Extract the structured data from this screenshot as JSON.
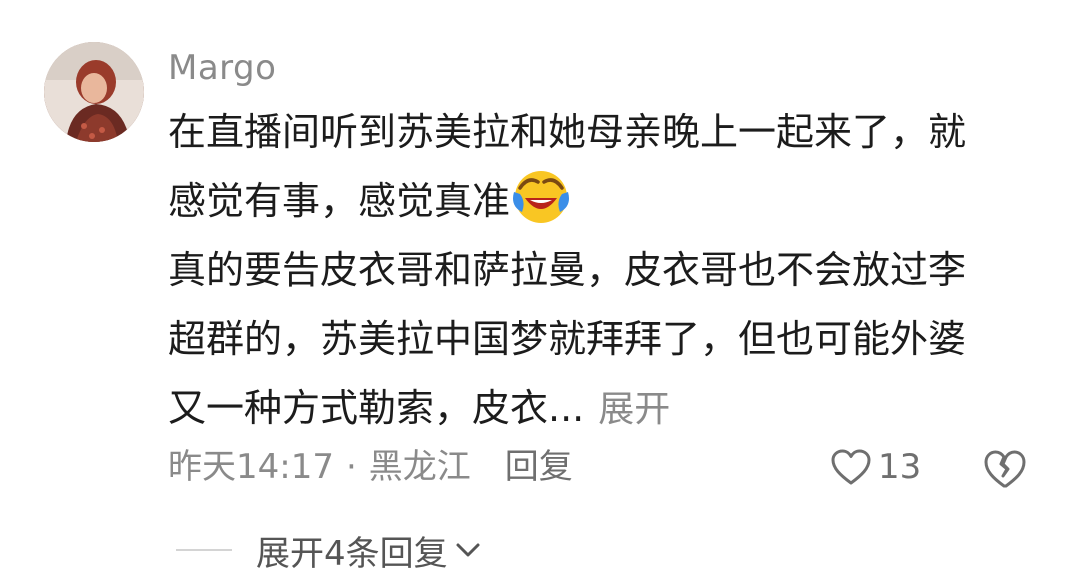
{
  "comment": {
    "username": "Margo",
    "text_lines": [
      "在直播间听到苏美拉和她母亲晚上一起来了，就",
      "感觉有事，感觉真准",
      "真的要告皮衣哥和萨拉曼，皮衣哥也不会放过李",
      "超群的，苏美拉中国梦就拜拜了，但也可能外婆",
      "又一种方式勒索，皮衣..."
    ],
    "emoji": "laughing-crying-emoji",
    "expand_label": "展开",
    "timestamp": "昨天14:17",
    "separator": "·",
    "location": "黑龙江",
    "reply_label": "回复",
    "like_count": "13",
    "expand_replies_label": "展开4条回复"
  },
  "icons": {
    "like": "heart-outline-icon",
    "dislike": "broken-heart-icon",
    "chevron": "chevron-down-icon"
  },
  "colors": {
    "primary_text": "#1c1c1c",
    "secondary_text": "#8a8a8a",
    "emoji_yellow": "#f9c623",
    "emoji_tear": "#3b8ee8"
  }
}
